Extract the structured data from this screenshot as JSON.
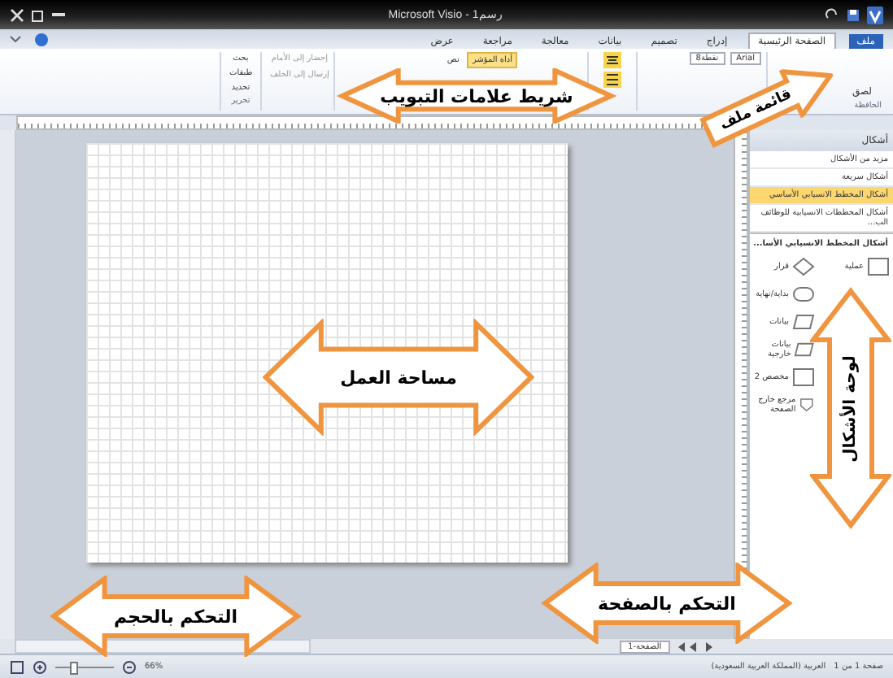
{
  "window": {
    "title": "Microsoft Visio - رسم1"
  },
  "tabs": [
    {
      "label": "ملف",
      "selected": false,
      "kind": "file"
    },
    {
      "label": "الصفحة الرئيسية",
      "selected": true,
      "kind": "tab"
    },
    {
      "label": "إدراج",
      "selected": false,
      "kind": "tab"
    },
    {
      "label": "تصميم",
      "selected": false,
      "kind": "tab"
    },
    {
      "label": "بيانات",
      "selected": false,
      "kind": "tab"
    },
    {
      "label": "معالجة",
      "selected": false,
      "kind": "tab"
    },
    {
      "label": "مراجعة",
      "selected": false,
      "kind": "tab"
    },
    {
      "label": "عرض",
      "selected": false,
      "kind": "tab"
    }
  ],
  "ribbon": {
    "paste": "لصق",
    "clipboard_group": "الحافظة",
    "font": "Arial",
    "font_size": "8نقطة",
    "pointer_tool": "أداة المؤشر",
    "text_tool": "نص",
    "bring_forward": "إحضار إلى الأمام",
    "send_backward": "إرسال إلى الخلف",
    "find": "بحث",
    "layers": "طبقات",
    "select": "تحديد",
    "editing_group": "تحرير"
  },
  "shapes_pane": {
    "title": "أشكال",
    "items": [
      {
        "label": "مزيد من الأشكال",
        "selected": false
      },
      {
        "label": "أشكال سريعة",
        "selected": false
      },
      {
        "label": "أشكال المخطط الانسيابي الأساسي",
        "selected": true
      },
      {
        "label": "أشكال المخططات الانسيابية للوظائف الب...",
        "selected": false
      }
    ],
    "stencil_title": "أشكال المخطط الانسيابي الأسا...",
    "shapes": [
      {
        "label": "عملية",
        "kind": "process"
      },
      {
        "label": "قرار",
        "kind": "decision"
      },
      {
        "label": "بداية/نهاية",
        "kind": "terminator"
      },
      {
        "label": "بيانات",
        "kind": "data"
      },
      {
        "label": "بيانات خارجية",
        "kind": "data"
      },
      {
        "label": "مخصص 2",
        "kind": "process"
      },
      {
        "label": "مرجع خارج الصفحة",
        "kind": "offpage"
      }
    ]
  },
  "page_tab": "الصفحة-1",
  "status_bar": {
    "page": "صفحة 1 من 1",
    "language": "العربية (المملكة العربية السعودية)",
    "zoom": "66%",
    "level": 0.3
  },
  "callouts": [
    {
      "kind": "pointer",
      "text": "قائمة ملف"
    },
    {
      "kind": "double-h",
      "text": "شريط علامات التبويب"
    },
    {
      "kind": "double-v",
      "text": "لوحة الأشكال"
    },
    {
      "kind": "double-h",
      "text": "مساحة العمل"
    },
    {
      "kind": "double-h",
      "text": "التحكم بالصفحة"
    },
    {
      "kind": "double-h",
      "text": "التحكم بالحجم"
    }
  ]
}
